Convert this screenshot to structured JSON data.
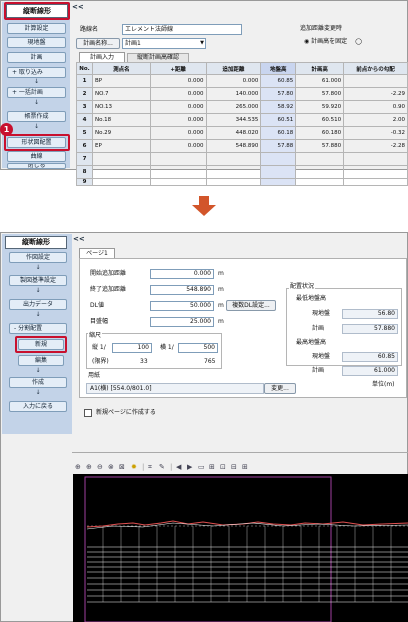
{
  "top": {
    "title": "縦断線形",
    "collapse": "<<",
    "sidebar": [
      "計算設定",
      "現地盤",
      "計画",
      "+ 取り込み",
      "↓",
      "+ 一括計画",
      "↓",
      "帳票作成",
      "↓",
      "形状図配置",
      "曲線",
      "閉じる"
    ],
    "fields": {
      "route_label": "路線名",
      "route_value": "エレメント法師線",
      "plan_btn": "計画名称...",
      "plan_value": "計画1",
      "group_label": "追加距離変更時",
      "radio1": "計画高を固定",
      "radio2": "◯"
    },
    "tabs": [
      "計画入力",
      "縦断計画高確認"
    ],
    "table": {
      "headers": [
        "No.",
        "測点名",
        "+距離",
        "追加距離",
        "地盤高",
        "計画高",
        "前点からの勾配"
      ],
      "rows": [
        [
          "1",
          "BP",
          "0.000",
          "0.000",
          "60.85",
          "61.000",
          ""
        ],
        [
          "2",
          "NO.7",
          "0.000",
          "140.000",
          "57.80",
          "57.800",
          "-2.29"
        ],
        [
          "3",
          "NO.13",
          "0.000",
          "265.000",
          "58.92",
          "59.920",
          "0.90"
        ],
        [
          "4",
          "No.18",
          "0.000",
          "344.535",
          "60.51",
          "60.510",
          "2.00"
        ],
        [
          "5",
          "No.29",
          "0.000",
          "448.020",
          "60.18",
          "60.180",
          "-0.32"
        ],
        [
          "6",
          "EP",
          "0.000",
          "548.890",
          "57.88",
          "57.880",
          "-2.28"
        ],
        [
          "7",
          "",
          "",
          "",
          "",
          "",
          ""
        ],
        [
          "8",
          "",
          "",
          "",
          "",
          "",
          ""
        ],
        [
          "9",
          "",
          "",
          "",
          "",
          "",
          ""
        ]
      ]
    },
    "callout": "1"
  },
  "bottom": {
    "title": "縦断線形",
    "collapse": "<<",
    "sidebar": [
      "作図設定",
      "↓",
      "製図基準設定",
      "↓",
      "出力データ",
      "↓",
      "- 分割配置",
      "新規",
      "編集",
      "↓",
      "作成",
      "↓",
      "入力に戻る"
    ],
    "page_tab": "ページ1",
    "form": {
      "start_label": "開始追加距離",
      "start_value": "0.000",
      "start_unit": "m",
      "end_label": "終了追加距離",
      "end_value": "548.890",
      "end_unit": "m",
      "dl_label": "DL値",
      "dl_value": "50.000",
      "dl_unit": "m",
      "dl_btn": "複数DL設定...",
      "grid_label": "目盛幅",
      "grid_value": "25.000",
      "grid_unit": "m",
      "scale_label": "縮尺",
      "vert_label": "縦 1/",
      "vert_value": "100",
      "horiz_label": "横 1/",
      "horiz_value": "500",
      "limit_label": "(限界)",
      "limit_v": "33",
      "limit_h": "765",
      "paper_label": "用紙",
      "paper_value": "A1(横) [554.0/801.0]",
      "change_btn": "変更...",
      "newpage_label": "新規ページに作成する"
    },
    "status": {
      "title": "配置状況",
      "min_label": "最低地盤高",
      "ground1_label": "現地盤",
      "ground1": "56.80",
      "plan1_label": "計画",
      "plan1": "57.880",
      "max_label": "最高地盤高",
      "ground2_label": "現地盤",
      "ground2": "60.85",
      "plan2_label": "計画",
      "plan2": "61.000",
      "unit": "単位(m)"
    }
  },
  "colors": {
    "accent": "#c8102e",
    "arrow": "#d2552a",
    "sidebar_bg": "#c3d3e8",
    "header_bg": "#dfe6ef",
    "highlight": "#dbe3f5",
    "canvas": "#000000",
    "plot_frame": "#a040a0"
  }
}
